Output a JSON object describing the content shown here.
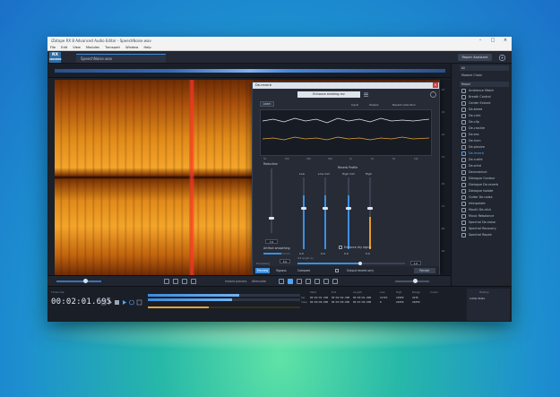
{
  "window": {
    "title": "iZotope RX 8 Advanced Audio Editor - SpeechNoise.wav",
    "menu": [
      "File",
      "Edit",
      "View",
      "Modules",
      "Transport",
      "Window",
      "Help"
    ],
    "file_tab": "SpeechNoise.wav",
    "repair_button": "Repair Assistant",
    "logo_text": "RX",
    "logo_sub": "ADVANCED"
  },
  "scale": [
    "-20",
    "-30",
    "-40",
    "-50",
    "-60",
    "-70",
    "-80",
    "-90"
  ],
  "bottom": {
    "instant_process": "Instant process",
    "attenuate": "Attenuate"
  },
  "transport": {
    "timecode_label": "Timecode",
    "timecode": "00:02:01.695",
    "selection_headers": [
      "Start",
      "End",
      "Length",
      "Low",
      "High",
      "Range",
      "Cursor"
    ],
    "selection_label": "Sel",
    "view_label": "View",
    "sel_values": [
      "00:02:01.500",
      "00:02:02.500",
      "00:00:01.000",
      "12763",
      "15000",
      "2236"
    ],
    "view_values": [
      "00:00:00.000",
      "00:03:09.000",
      "00:03:09.000",
      "0",
      "22050",
      "22050"
    ],
    "history_header": "History",
    "history_item": "Initial State"
  },
  "sidebar": {
    "filter": "All",
    "heading": "Module Chain",
    "group": "Repair",
    "modules": [
      "Ambience Match",
      "Breath Control",
      "Center Extract",
      "De-bleed",
      "De-click",
      "De-clip",
      "De-crackle",
      "De-ess",
      "De-hum",
      "De-plosive",
      "De-reverb",
      "De-rustle",
      "De-wind",
      "Deconstruct",
      "Dialogue Contour",
      "Dialogue De-reverb",
      "Dialogue Isolate",
      "Guitar De-noise",
      "Interpolate",
      "Mouth De-click",
      "Music Rebalance",
      "Spectral De-noise",
      "Spectral Recovery",
      "Spectral Repair"
    ],
    "active_module": "De-reverb",
    "accent": "#4fa7ff"
  },
  "dialog": {
    "title": "De-reverb",
    "preset": "Enhance existing rev",
    "learn": "Learn",
    "legend": [
      "Input",
      "Output",
      "Reverb reduction"
    ],
    "graph_scale": [
      "50",
      "100",
      "200",
      "500",
      "1k",
      "2k",
      "5k",
      "10k"
    ],
    "reduction_label": "Reduction",
    "reverb_profile_label": "Reverb Profile",
    "bands": [
      {
        "name": "Low",
        "value": "0.0"
      },
      {
        "name": "Low mid",
        "value": "0.0"
      },
      {
        "name": "High mid",
        "value": "0.0"
      },
      {
        "name": "High",
        "value": "0.0"
      }
    ],
    "tail_length_label": "Tail length (s)",
    "tail_length_value": "1.0",
    "artifact_smoothing_label": "Artifact smoothing",
    "artifact_smoothing_value": "5.0",
    "reduction_value": "7.0",
    "enhance_dry_label": "Enhance dry signal",
    "processing_label": "Processing",
    "output_reverb_label": "Output reverb only",
    "render_button": "Render",
    "bypass_label": "Bypass",
    "compare_label": "Compare",
    "preview_label": "Preview"
  }
}
